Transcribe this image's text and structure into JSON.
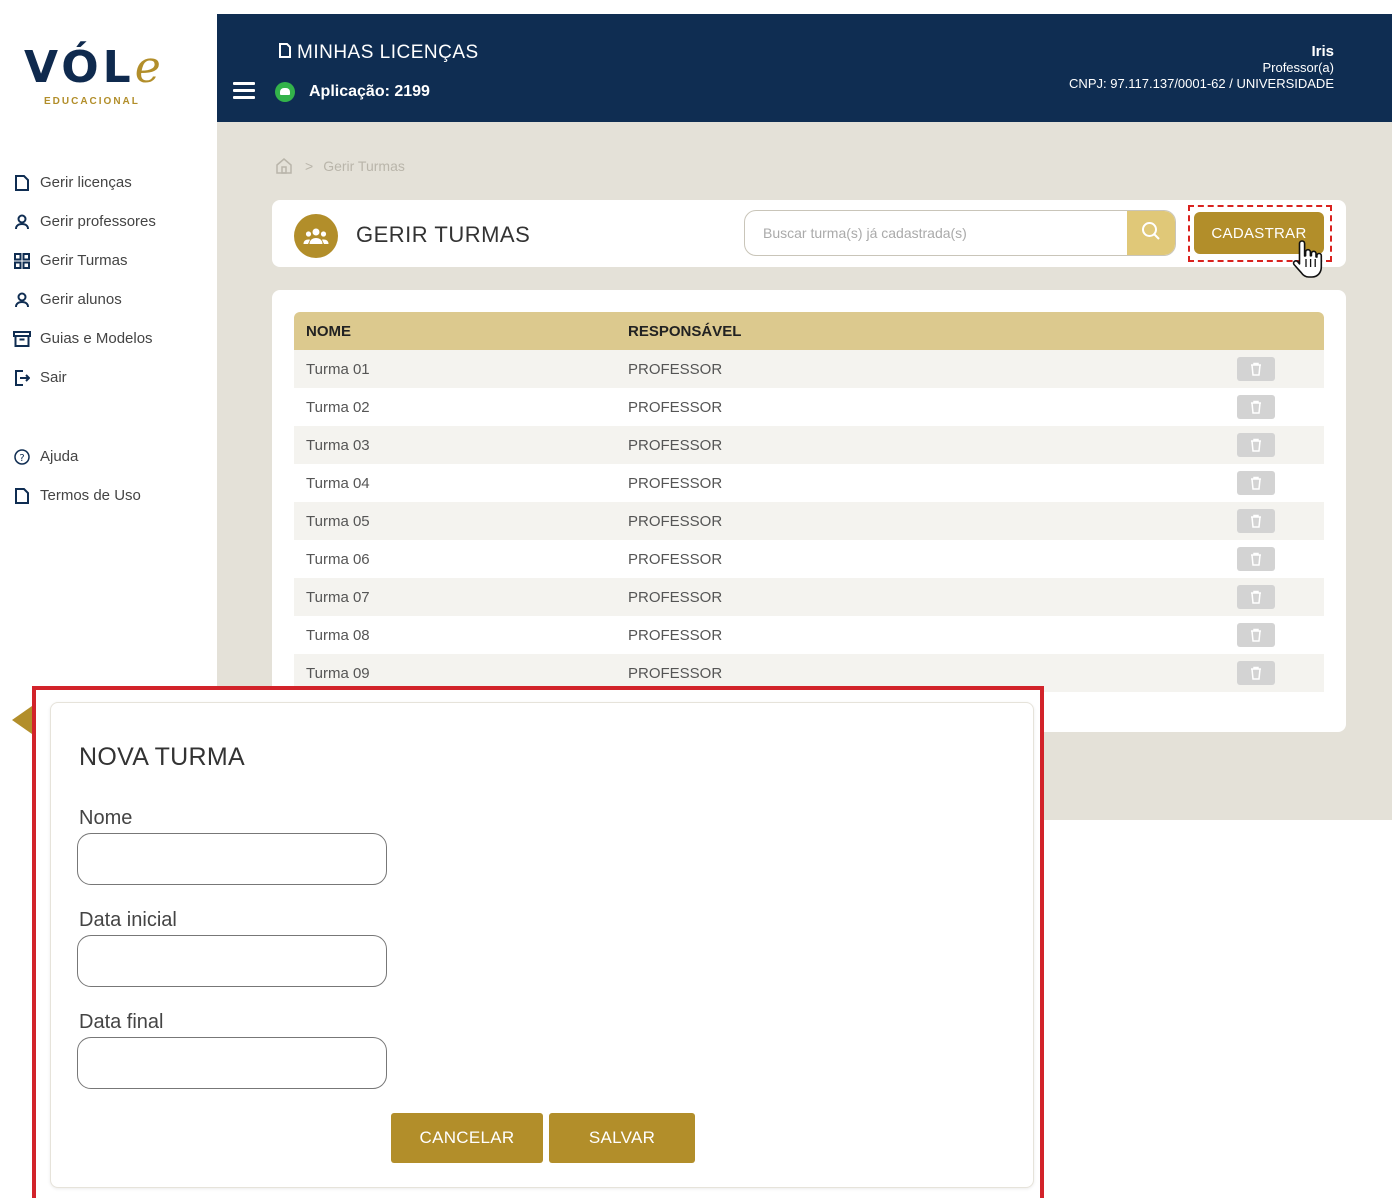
{
  "sidebar": {
    "logo": {
      "main": "VÓL",
      "accent": "e",
      "sub": "EDUCACIONAL"
    },
    "items": [
      {
        "label": "Gerir licenças",
        "icon": "document-icon"
      },
      {
        "label": "Gerir professores",
        "icon": "user-icon"
      },
      {
        "label": "Gerir Turmas",
        "icon": "grid-icon"
      },
      {
        "label": "Gerir alunos",
        "icon": "user-icon"
      },
      {
        "label": "Guias e Modelos",
        "icon": "archive-icon"
      },
      {
        "label": "Sair",
        "icon": "logout-icon"
      }
    ],
    "help_items": [
      {
        "label": "Ajuda",
        "icon": "help-circle-icon"
      },
      {
        "label": "Termos de Uso",
        "icon": "document-icon"
      }
    ]
  },
  "header": {
    "title": "MINHAS LICENÇAS",
    "app_label": "Aplicação: 2199",
    "user_name": "Iris",
    "user_role": "Professor(a)",
    "user_org": "CNPJ: 97.117.137/0001-62 / UNIVERSIDADE"
  },
  "breadcrumb": {
    "current": "Gerir Turmas",
    "separator": ">"
  },
  "toolbar": {
    "title": "GERIR TURMAS",
    "search_placeholder": "Buscar turma(s) já cadastrada(s)",
    "register_label": "CADASTRAR"
  },
  "table": {
    "columns": [
      "NOME",
      "RESPONSÁVEL",
      ""
    ],
    "rows": [
      {
        "name": "Turma 01",
        "responsible": "PROFESSOR"
      },
      {
        "name": "Turma 02",
        "responsible": "PROFESSOR"
      },
      {
        "name": "Turma 03",
        "responsible": "PROFESSOR"
      },
      {
        "name": "Turma 04",
        "responsible": "PROFESSOR"
      },
      {
        "name": "Turma 05",
        "responsible": "PROFESSOR"
      },
      {
        "name": "Turma 06",
        "responsible": "PROFESSOR"
      },
      {
        "name": "Turma 07",
        "responsible": "PROFESSOR"
      },
      {
        "name": "Turma 08",
        "responsible": "PROFESSOR"
      },
      {
        "name": "Turma 09",
        "responsible": "PROFESSOR"
      }
    ]
  },
  "modal": {
    "title": "NOVA TURMA",
    "fields": [
      {
        "label": "Nome",
        "value": ""
      },
      {
        "label": "Data inicial",
        "value": ""
      },
      {
        "label": "Data final",
        "value": ""
      }
    ],
    "cancel_label": "CANCELAR",
    "save_label": "SALVAR"
  },
  "colors": {
    "navy": "#0f2d52",
    "gold": "#b28e2a",
    "gold_light": "#dcc98e",
    "highlight_red": "#d2232a",
    "content_bg": "#e4e1d8"
  }
}
